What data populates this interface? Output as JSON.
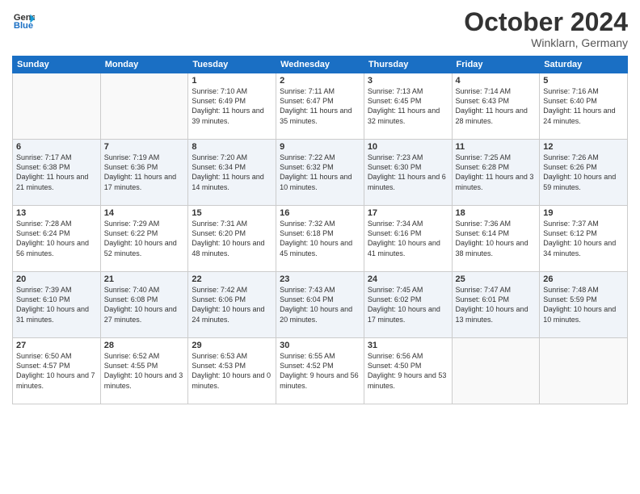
{
  "header": {
    "logo": {
      "general": "General",
      "blue": "Blue"
    },
    "title": "October 2024",
    "location": "Winklarn, Germany"
  },
  "days_of_week": [
    "Sunday",
    "Monday",
    "Tuesday",
    "Wednesday",
    "Thursday",
    "Friday",
    "Saturday"
  ],
  "weeks": [
    [
      {
        "day": "",
        "sunrise": "",
        "sunset": "",
        "daylight": ""
      },
      {
        "day": "",
        "sunrise": "",
        "sunset": "",
        "daylight": ""
      },
      {
        "day": "1",
        "sunrise": "Sunrise: 7:10 AM",
        "sunset": "Sunset: 6:49 PM",
        "daylight": "Daylight: 11 hours and 39 minutes."
      },
      {
        "day": "2",
        "sunrise": "Sunrise: 7:11 AM",
        "sunset": "Sunset: 6:47 PM",
        "daylight": "Daylight: 11 hours and 35 minutes."
      },
      {
        "day": "3",
        "sunrise": "Sunrise: 7:13 AM",
        "sunset": "Sunset: 6:45 PM",
        "daylight": "Daylight: 11 hours and 32 minutes."
      },
      {
        "day": "4",
        "sunrise": "Sunrise: 7:14 AM",
        "sunset": "Sunset: 6:43 PM",
        "daylight": "Daylight: 11 hours and 28 minutes."
      },
      {
        "day": "5",
        "sunrise": "Sunrise: 7:16 AM",
        "sunset": "Sunset: 6:40 PM",
        "daylight": "Daylight: 11 hours and 24 minutes."
      }
    ],
    [
      {
        "day": "6",
        "sunrise": "Sunrise: 7:17 AM",
        "sunset": "Sunset: 6:38 PM",
        "daylight": "Daylight: 11 hours and 21 minutes."
      },
      {
        "day": "7",
        "sunrise": "Sunrise: 7:19 AM",
        "sunset": "Sunset: 6:36 PM",
        "daylight": "Daylight: 11 hours and 17 minutes."
      },
      {
        "day": "8",
        "sunrise": "Sunrise: 7:20 AM",
        "sunset": "Sunset: 6:34 PM",
        "daylight": "Daylight: 11 hours and 14 minutes."
      },
      {
        "day": "9",
        "sunrise": "Sunrise: 7:22 AM",
        "sunset": "Sunset: 6:32 PM",
        "daylight": "Daylight: 11 hours and 10 minutes."
      },
      {
        "day": "10",
        "sunrise": "Sunrise: 7:23 AM",
        "sunset": "Sunset: 6:30 PM",
        "daylight": "Daylight: 11 hours and 6 minutes."
      },
      {
        "day": "11",
        "sunrise": "Sunrise: 7:25 AM",
        "sunset": "Sunset: 6:28 PM",
        "daylight": "Daylight: 11 hours and 3 minutes."
      },
      {
        "day": "12",
        "sunrise": "Sunrise: 7:26 AM",
        "sunset": "Sunset: 6:26 PM",
        "daylight": "Daylight: 10 hours and 59 minutes."
      }
    ],
    [
      {
        "day": "13",
        "sunrise": "Sunrise: 7:28 AM",
        "sunset": "Sunset: 6:24 PM",
        "daylight": "Daylight: 10 hours and 56 minutes."
      },
      {
        "day": "14",
        "sunrise": "Sunrise: 7:29 AM",
        "sunset": "Sunset: 6:22 PM",
        "daylight": "Daylight: 10 hours and 52 minutes."
      },
      {
        "day": "15",
        "sunrise": "Sunrise: 7:31 AM",
        "sunset": "Sunset: 6:20 PM",
        "daylight": "Daylight: 10 hours and 48 minutes."
      },
      {
        "day": "16",
        "sunrise": "Sunrise: 7:32 AM",
        "sunset": "Sunset: 6:18 PM",
        "daylight": "Daylight: 10 hours and 45 minutes."
      },
      {
        "day": "17",
        "sunrise": "Sunrise: 7:34 AM",
        "sunset": "Sunset: 6:16 PM",
        "daylight": "Daylight: 10 hours and 41 minutes."
      },
      {
        "day": "18",
        "sunrise": "Sunrise: 7:36 AM",
        "sunset": "Sunset: 6:14 PM",
        "daylight": "Daylight: 10 hours and 38 minutes."
      },
      {
        "day": "19",
        "sunrise": "Sunrise: 7:37 AM",
        "sunset": "Sunset: 6:12 PM",
        "daylight": "Daylight: 10 hours and 34 minutes."
      }
    ],
    [
      {
        "day": "20",
        "sunrise": "Sunrise: 7:39 AM",
        "sunset": "Sunset: 6:10 PM",
        "daylight": "Daylight: 10 hours and 31 minutes."
      },
      {
        "day": "21",
        "sunrise": "Sunrise: 7:40 AM",
        "sunset": "Sunset: 6:08 PM",
        "daylight": "Daylight: 10 hours and 27 minutes."
      },
      {
        "day": "22",
        "sunrise": "Sunrise: 7:42 AM",
        "sunset": "Sunset: 6:06 PM",
        "daylight": "Daylight: 10 hours and 24 minutes."
      },
      {
        "day": "23",
        "sunrise": "Sunrise: 7:43 AM",
        "sunset": "Sunset: 6:04 PM",
        "daylight": "Daylight: 10 hours and 20 minutes."
      },
      {
        "day": "24",
        "sunrise": "Sunrise: 7:45 AM",
        "sunset": "Sunset: 6:02 PM",
        "daylight": "Daylight: 10 hours and 17 minutes."
      },
      {
        "day": "25",
        "sunrise": "Sunrise: 7:47 AM",
        "sunset": "Sunset: 6:01 PM",
        "daylight": "Daylight: 10 hours and 13 minutes."
      },
      {
        "day": "26",
        "sunrise": "Sunrise: 7:48 AM",
        "sunset": "Sunset: 5:59 PM",
        "daylight": "Daylight: 10 hours and 10 minutes."
      }
    ],
    [
      {
        "day": "27",
        "sunrise": "Sunrise: 6:50 AM",
        "sunset": "Sunset: 4:57 PM",
        "daylight": "Daylight: 10 hours and 7 minutes."
      },
      {
        "day": "28",
        "sunrise": "Sunrise: 6:52 AM",
        "sunset": "Sunset: 4:55 PM",
        "daylight": "Daylight: 10 hours and 3 minutes."
      },
      {
        "day": "29",
        "sunrise": "Sunrise: 6:53 AM",
        "sunset": "Sunset: 4:53 PM",
        "daylight": "Daylight: 10 hours and 0 minutes."
      },
      {
        "day": "30",
        "sunrise": "Sunrise: 6:55 AM",
        "sunset": "Sunset: 4:52 PM",
        "daylight": "Daylight: 9 hours and 56 minutes."
      },
      {
        "day": "31",
        "sunrise": "Sunrise: 6:56 AM",
        "sunset": "Sunset: 4:50 PM",
        "daylight": "Daylight: 9 hours and 53 minutes."
      },
      {
        "day": "",
        "sunrise": "",
        "sunset": "",
        "daylight": ""
      },
      {
        "day": "",
        "sunrise": "",
        "sunset": "",
        "daylight": ""
      }
    ]
  ]
}
